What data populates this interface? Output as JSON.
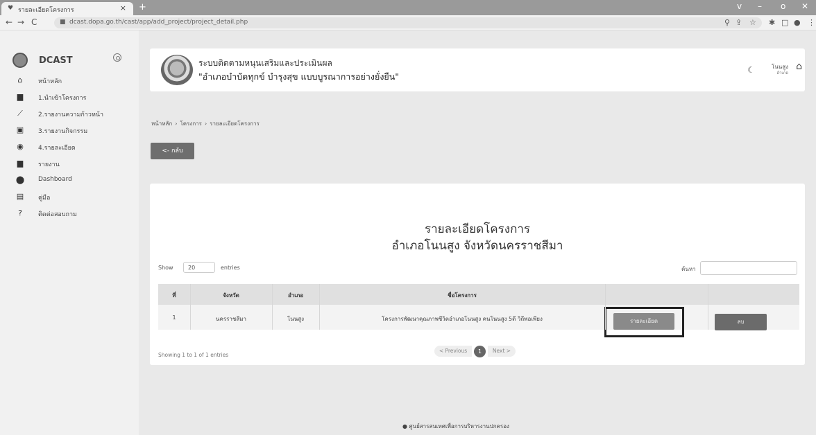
{
  "browser": {
    "tab_title": "รายละเอียดโครงการ",
    "tab_icon": "shield-icon",
    "new_tab": "+",
    "url": "dcast.dopa.go.th/cast/app/add_project/project_detail.php",
    "window_controls": [
      "v",
      "–",
      "o",
      "✕"
    ]
  },
  "sidebar": {
    "brand": "DCAST",
    "items": [
      {
        "label": "หน้าหลัก",
        "icon": "home-icon"
      },
      {
        "label": "1.นำเข้าโครงการ",
        "icon": "folder-icon"
      },
      {
        "label": "2.รายงานความก้าวหน้า",
        "icon": "chart-icon"
      },
      {
        "label": "3.รายงานกิจกรรม",
        "icon": "image-icon"
      },
      {
        "label": "4.รายละเอียด",
        "icon": "eye-icon"
      },
      {
        "label": "รายงาน",
        "icon": "folder-icon"
      },
      {
        "label": "Dashboard",
        "icon": "location-pin-icon"
      },
      {
        "label": "คู่มือ",
        "icon": "book-icon"
      },
      {
        "label": "ติดต่อสอบถาม",
        "icon": "question-icon"
      }
    ]
  },
  "header": {
    "line1": "ระบบติดตามหนุนเสริมและประเมินผล",
    "line2": "\"อำเภอบำบัดทุกข์ บำรุงสุข แบบบูรณาการอย่างยั่งยืน\"",
    "user_name": "โนนสูง",
    "user_role": "อำเภอ"
  },
  "breadcrumb": [
    "หน้าหลัก",
    "โครงการ",
    "รายละเอียดโครงการ"
  ],
  "back_label": "<- กลับ",
  "card": {
    "title1": "รายละเอียดโครงการ",
    "title2": "อำเภอโนนสูง จังหวัดนครราชสีมา",
    "show_label": "Show",
    "page_length": "20",
    "entries_label": "entries",
    "search_label": "ค้นหา",
    "search_value": "",
    "columns": [
      "ที่",
      "จังหวัด",
      "อำเภอ",
      "ชื่อโครงการ"
    ],
    "row": {
      "no": "1",
      "province": "นครราชสีมา",
      "district": "โนนสูง",
      "project": "โครงการพัฒนาคุณภาพชีวิตอำเภอโนนสูง คนโนนสูง 5ดี วิถีพอเพียง",
      "detail_btn": "รายละเอียด",
      "delete_btn": "ลบ"
    },
    "info": "Showing 1 to 1 of 1 entries",
    "prev": "< Previous",
    "page": "1",
    "next": "Next >"
  },
  "footer": "ศูนย์สารสนเทศเพื่อการบริหารงานปกครอง"
}
